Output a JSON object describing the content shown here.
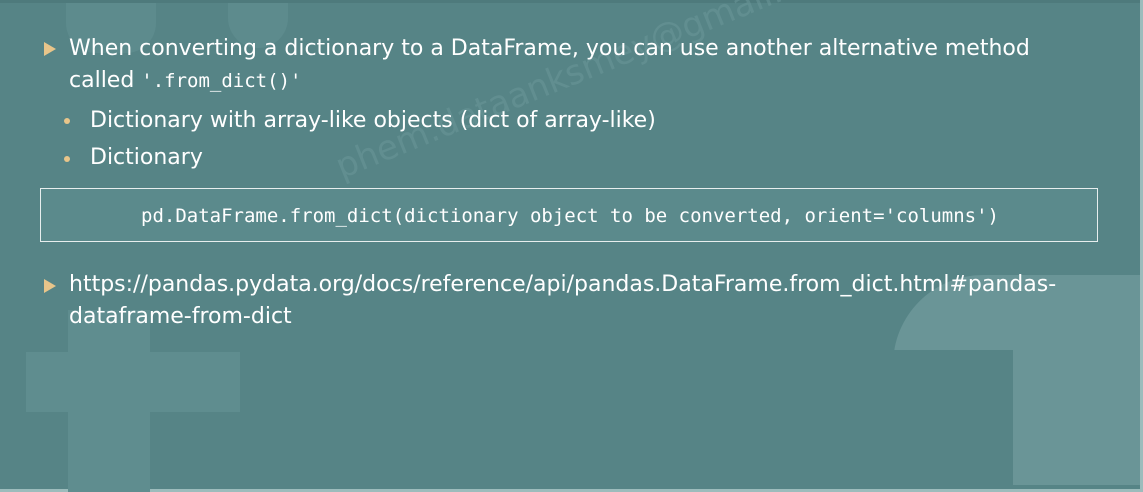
{
  "slide": {
    "bullets": {
      "b1_line1": "When converting a dictionary to a DataFrame, you can use another alternative method",
      "b1_line2_prefix": "called ",
      "b1_code": "'.from_dict()'",
      "sub1": "Dictionary with array-like objects (dict of array-like)",
      "sub2": "Dictionary",
      "b2_line1": "https://pandas.pydata.org/docs/reference/api/pandas.DataFrame.from_dict.html#pandas-",
      "b2_line2": "dataframe-from-dict"
    },
    "code": "pd.DataFrame.from_dict(dictionary object to be converted, orient='columns')",
    "watermark": "phem.dataanksmey@gmail.com"
  },
  "colors": {
    "background": "#568486",
    "bullet_accent": "#e8c58a",
    "text": "#ffffff"
  }
}
